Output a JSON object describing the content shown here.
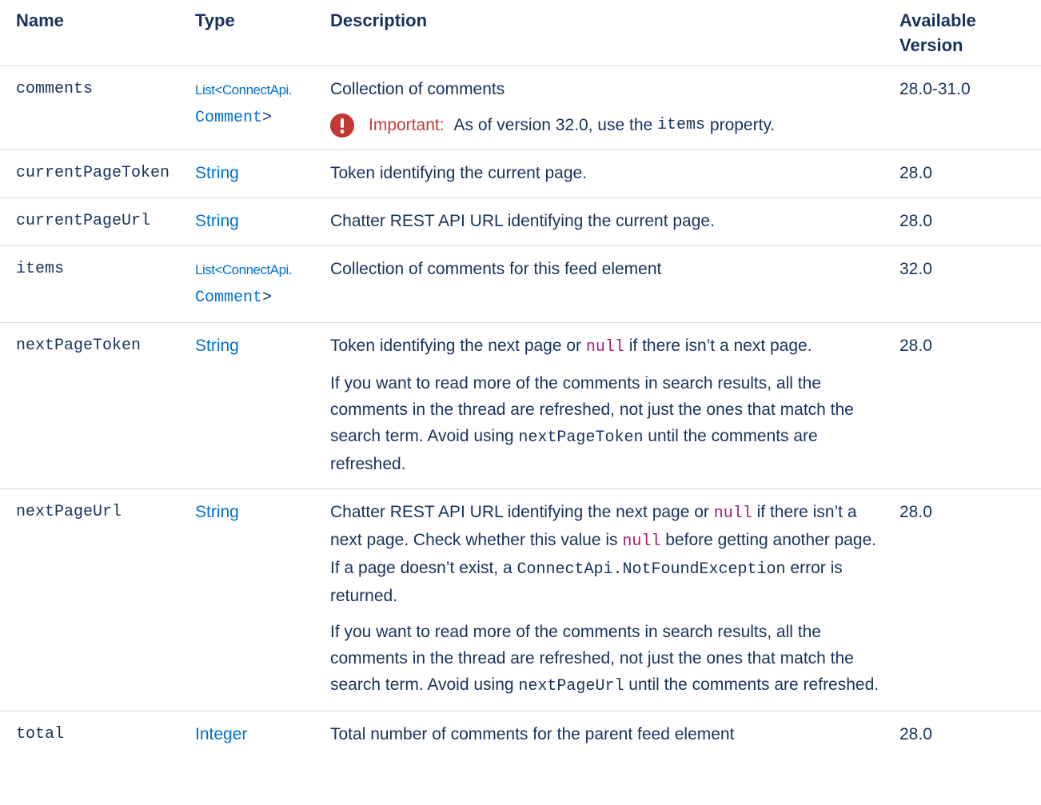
{
  "headers": {
    "name": "Name",
    "type": "Type",
    "description": "Description",
    "version_line1": "Available",
    "version_line2": "Version"
  },
  "rows": {
    "comments": {
      "name": "comments",
      "type_line1_a": "List",
      "type_line1_b": "<",
      "type_line1_c": "ConnectApi.",
      "type_line2_a": "Comment",
      "type_line2_b": ">",
      "desc": "Collection of comments",
      "important_label": "Important:",
      "important_pre": "As of version 32.0, use the",
      "important_code": "items",
      "important_post": "property.",
      "version": "28.0-31.0"
    },
    "currentPageToken": {
      "name": "currentPageToken",
      "type": "String",
      "desc": "Token identifying the current page.",
      "version": "28.0"
    },
    "currentPageUrl": {
      "name": "currentPageUrl",
      "type": "String",
      "desc": "Chatter REST API URL identifying the current page.",
      "version": "28.0"
    },
    "items": {
      "name": "items",
      "type_line1_a": "List",
      "type_line1_b": "<",
      "type_line1_c": "ConnectApi.",
      "type_line2_a": "Comment",
      "type_line2_b": ">",
      "desc": "Collection of comments for this feed element",
      "version": "32.0"
    },
    "nextPageToken": {
      "name": "nextPageToken",
      "type": "String",
      "p1_pre": "Token identifying the next page or",
      "p1_null": "null",
      "p1_post": "if there isn’t a next page.",
      "p2_pre": "If you want to read more of the comments in search results, all the comments in the thread are refreshed, not just the ones that match the search term. Avoid using",
      "p2_code": "nextPageToken",
      "p2_post": "until the comments are refreshed.",
      "version": "28.0"
    },
    "nextPageUrl": {
      "name": "nextPageUrl",
      "type": "String",
      "p1_pre": "Chatter REST API URL identifying the next page or",
      "p1_null": "null",
      "p1_mid": "if there isn’t a next page. Check whether this value is",
      "p1_null2": "null",
      "p1_mid2": "before getting another page. If a page doesn’t exist, a",
      "p1_code": "ConnectApi.NotFoundException",
      "p1_post": "error is returned.",
      "p2_pre": "If you want to read more of the comments in search results, all the comments in the thread are refreshed, not just the ones that match the search term. Avoid using",
      "p2_code": "nextPageUrl",
      "p2_post": "until the comments are refreshed.",
      "version": "28.0"
    },
    "total": {
      "name": "total",
      "type": "Integer",
      "desc": "Total number of comments for the parent feed element",
      "version": "28.0"
    }
  },
  "colors": {
    "text": "#16325c",
    "link": "#0070d2",
    "null_keyword": "#a01f79",
    "important": "#c23934",
    "rule": "#d8dde6"
  },
  "icons": {
    "important": "exclamation-circle-icon"
  }
}
